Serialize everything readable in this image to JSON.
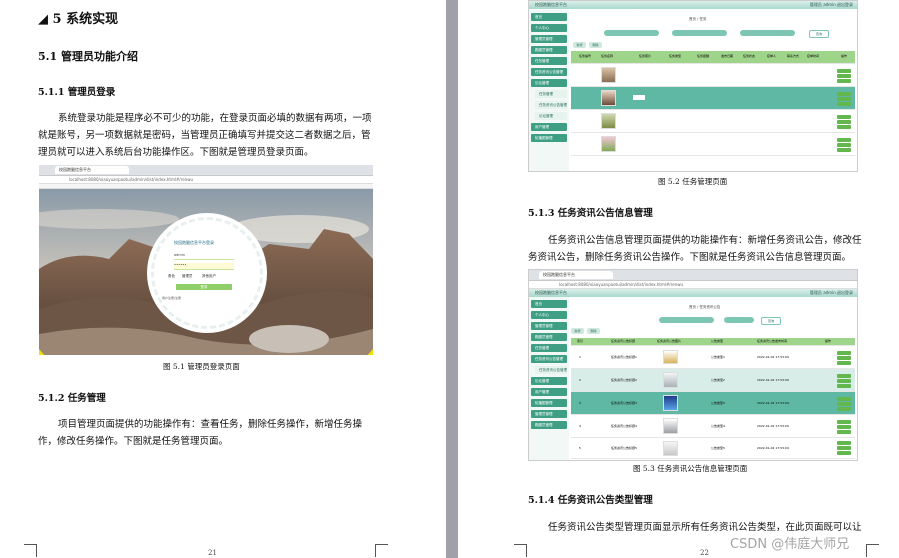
{
  "page_left": {
    "chapter": "◢ 5  系统实现",
    "sec_5_1": "5.1 管理员功能介绍",
    "sec_5_1_1": "5.1.1 管理员登录",
    "para_login": "系统登录功能是程序必不可少的功能，在登录页面必填的数据有两项，一项就是账号，另一项数据就是密码，当管理员正确填写并提交这二者数据之后，管理员就可以进入系统后台功能操作区。下图就是管理员登录页面。",
    "fig_5_1_caption": "图 5.1  管理员登录页面",
    "sec_5_1_2": "5.1.2  任务管理",
    "para_task": "项目管理页面提供的功能操作有：查看任务，删除任务操作，新增任务操作，修改任务操作。下图就是任务管理页面。",
    "page_number": "21"
  },
  "page_right": {
    "fig_5_2_caption": "图 5.2    任务管理页面",
    "sec_5_1_3": "5.1.3  任务资讯公告信息管理",
    "para_notice": "任务资讯公告信息管理页面提供的功能操作有：新增任务资讯公告，修改任务资讯公告，删除任务资讯公告操作。下图就是任务资讯公告信息管理页面。",
    "fig_5_3_caption": "图 5.3  任务资讯公告信息管理页面",
    "sec_5_1_4": "5.1.4 任务资讯公告类型管理",
    "para_type": "任务资讯公告类型管理页面显示所有任务资讯公告类型，在此页面既可以让",
    "page_number": "22"
  },
  "watermark": "CSDN @伟庭大师兄",
  "login_form": {
    "title": "校园跑腿信息平台登录",
    "username_value": "admin",
    "password_value": "••••••",
    "role_label": "角色",
    "role_options": [
      "管理员",
      "其他用户"
    ],
    "submit": "登录",
    "register_link": "用户注册/注册"
  },
  "screens": {
    "app_title": "校园跑腿信息平台",
    "user_info": "管理员 admin  退出登录",
    "tab_title": "校园跑腿信息平台",
    "url_text": "localhost:8080/xiaoyuanpaotui/admin/dist/index.html#/renwu",
    "task_breadcrumb": "首页 / 任务",
    "notice_breadcrumb": "首页 / 任务资讯公告",
    "search_button": "查询",
    "add_button": "新增",
    "delete_button": "删除",
    "action_buttons": [
      "详情",
      "修改",
      "删除"
    ],
    "sidebar_items": [
      "首页",
      "个人中心",
      "管理员管理",
      "跑腿员管理",
      "任务管理",
      "任务资讯公告管理",
      "论坛管理",
      "用户管理",
      "轮播图管理"
    ],
    "task_table_headers": [
      "任务编号",
      "任务名称",
      "任务照片",
      "任务类型",
      "任务报酬",
      "发布日期",
      "任务状态",
      "接单人",
      "联系方式",
      "接单时间",
      "操作"
    ],
    "notice_table_headers": [
      "索引",
      "任务资讯公告标题",
      "任务资讯公告图片",
      "公告类型",
      "任务资讯公告发布时间",
      "操作"
    ],
    "notice_rows": [
      {
        "index": "1",
        "title": "任务资讯公告标题1",
        "type": "公告类型1",
        "time": "2022-01-02 17:53:09"
      },
      {
        "index": "2",
        "title": "任务资讯公告标题2",
        "type": "公告类型2",
        "time": "2022-01-02 17:53:09"
      },
      {
        "index": "3",
        "title": "任务资讯公告标题3",
        "type": "公告类型3",
        "time": "2022-01-02 17:53:09"
      },
      {
        "index": "4",
        "title": "任务资讯公告标题4",
        "type": "公告类型4",
        "time": "2022-01-02 17:53:09"
      },
      {
        "index": "5",
        "title": "任务资讯公告标题5",
        "type": "公告类型5",
        "time": "2022-01-02 17:53:09"
      }
    ]
  },
  "colors": {
    "accent": "#3f9f85",
    "header_green": "#9fd58a",
    "highlight_row": "#5fb8a4",
    "page_bg": "#9ea2a8"
  }
}
